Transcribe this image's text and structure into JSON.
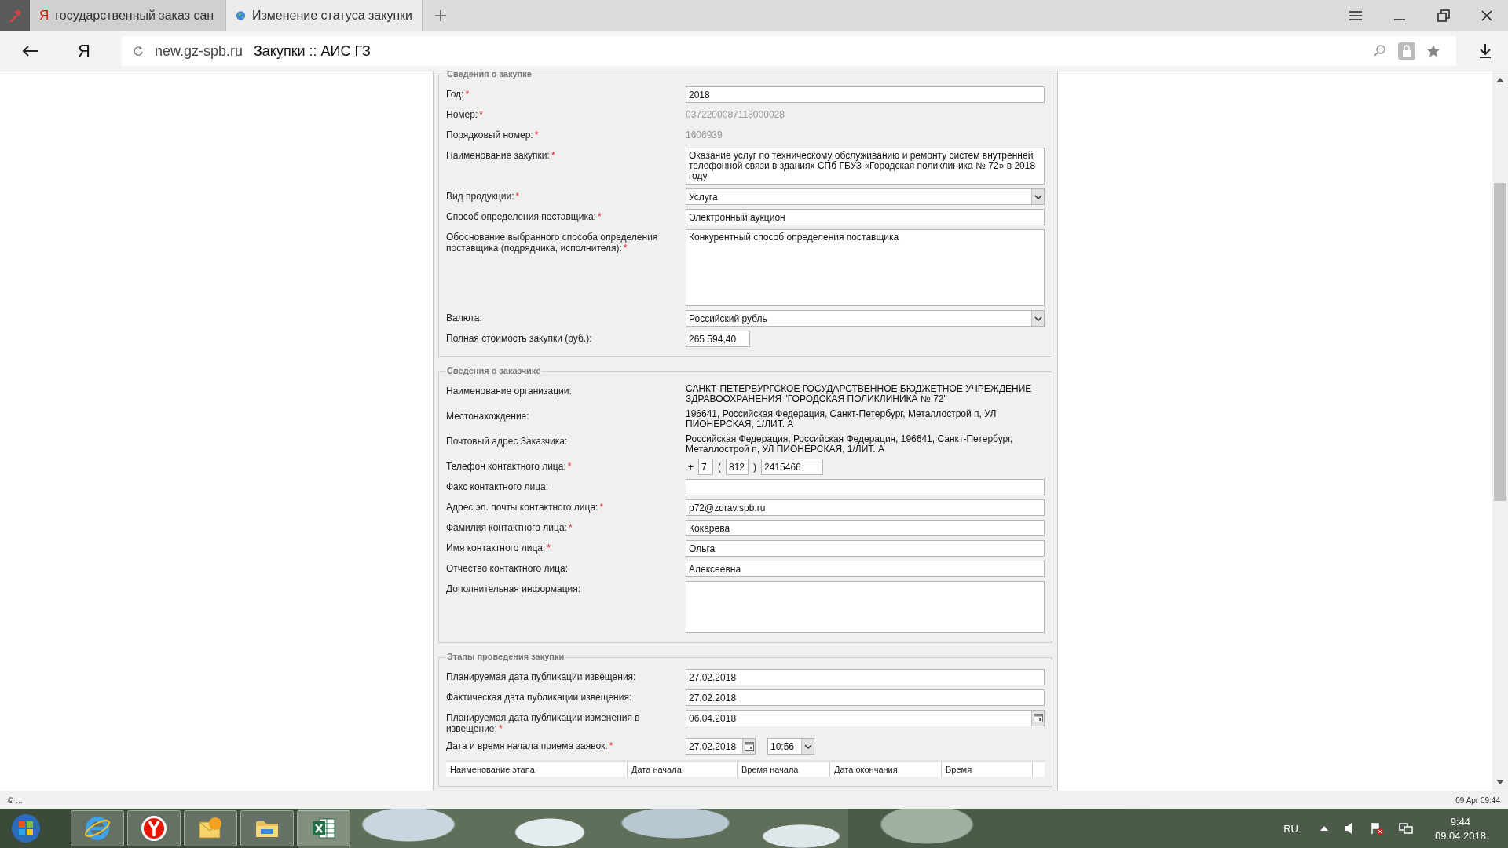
{
  "browser": {
    "tabs": [
      {
        "title": "государственный заказ сан",
        "logo": "Я",
        "selected": false
      },
      {
        "title": "Изменение статуса закупки",
        "selected": true
      }
    ],
    "address": {
      "logo": "Я",
      "domain": "new.gz-spb.ru",
      "page_title": "Закупки :: АИС ГЗ"
    }
  },
  "sections": [
    {
      "legend": "Сведения о закупке",
      "rows": [
        {
          "kind": "input",
          "label": "Год:",
          "mark": "*",
          "value": "2018"
        },
        {
          "kind": "readonly",
          "label": "Номер:",
          "mark": "*",
          "value": "0372200087118000028"
        },
        {
          "kind": "readonly",
          "label": "Порядковый номер:",
          "mark": "*",
          "value": "1606939"
        },
        {
          "kind": "text-block",
          "label": "Наименование закупки:",
          "mark": "*",
          "value": "Оказание услуг по техническому обслуживанию и ремонту систем внутренней телефонной связи в зданиях СПб ГБУЗ «Городская поликлиника № 72»  в 2018 году"
        },
        {
          "kind": "select",
          "label": "Вид продукции:",
          "mark": "*",
          "value": "Услуга"
        },
        {
          "kind": "input",
          "label": "Способ определения поставщика:",
          "mark": "*",
          "value": "Электронный аукцион"
        },
        {
          "kind": "textarea",
          "label": "Обоснование выбранного способа определения поставщика (подрядчика, исполнителя):",
          "mark": "*",
          "value": "Конкурентный способ определения поставщика"
        },
        {
          "kind": "select",
          "label": "Валюта:",
          "value": "Российский рубль"
        },
        {
          "kind": "short-input",
          "label": "Полная стоимость закупки (руб.):",
          "value": "265 594,40"
        }
      ]
    },
    {
      "legend": "Сведения о заказчике",
      "rows": [
        {
          "kind": "static",
          "label": "Наименование организации:",
          "value": "САНКТ-ПЕТЕРБУРГСКОЕ ГОСУДАРСТВЕННОЕ БЮДЖЕТНОЕ УЧРЕЖДЕНИЕ ЗДРАВООХРАНЕНИЯ \"ГОРОДСКАЯ ПОЛИКЛИНИКА № 72\""
        },
        {
          "kind": "static",
          "label": "Местонахождение:",
          "value": "196641, Российская Федерация, Санкт-Петербург, Металлострой п, УЛ ПИОНЕРСКАЯ, 1/ЛИТ. А"
        },
        {
          "kind": "static",
          "label": "Почтовый адрес Заказчика:",
          "value": "Российская Федерация, Российская Федерация, 196641, Санкт-Петербург, Металлострой п, УЛ ПИОНЕРСКАЯ, 1/ЛИТ. А"
        },
        {
          "kind": "phone",
          "label": "Телефон контактного лица:",
          "mark": "*",
          "prefix": "+",
          "country": "7",
          "open": "(",
          "area": "812",
          "close": ")",
          "number": "2415466"
        },
        {
          "kind": "input",
          "label": "Факс контактного лица:"
        },
        {
          "kind": "input",
          "label": "Адрес эл. почты контактного лица:",
          "mark": "*",
          "value": "p72@zdrav.spb.ru"
        },
        {
          "kind": "input",
          "label": "Фамилия контактного лица:",
          "mark": "*",
          "value": "Кокарева"
        },
        {
          "kind": "input",
          "label": "Имя контактного лица:",
          "mark": "*",
          "value": "Ольга"
        },
        {
          "kind": "input",
          "label": "Отчество контактного лица:",
          "value": "Алексеевна"
        },
        {
          "kind": "textarea-small",
          "label": "Дополнительная информация:"
        }
      ]
    },
    {
      "legend": "Этапы проведения закупки",
      "rows": [
        {
          "kind": "input",
          "label": "Планируемая дата публикации извещения:",
          "value": "27.02.2018"
        },
        {
          "kind": "input",
          "label": "Фактическая дата публикации извещения:",
          "value": "27.02.2018"
        },
        {
          "kind": "date",
          "label": "Планируемая дата публикации изменения в извещение:",
          "mark": "*",
          "value": "06.04.2018"
        },
        {
          "kind": "datetime",
          "label": "Дата и время начала приема заявок:",
          "mark": "*",
          "value": "27.02.2018",
          "time": "10:56"
        }
      ],
      "table": {
        "columns": [
          "Наименование этапа",
          "Дата начала",
          "Время начала",
          "Дата окончания",
          "Время"
        ]
      }
    }
  ],
  "status_bar": {
    "left": "© ...",
    "right": "09 Apr 09:44"
  },
  "taskbar": {
    "language": "RU",
    "time": "9:44",
    "date": "09.04.2018"
  }
}
